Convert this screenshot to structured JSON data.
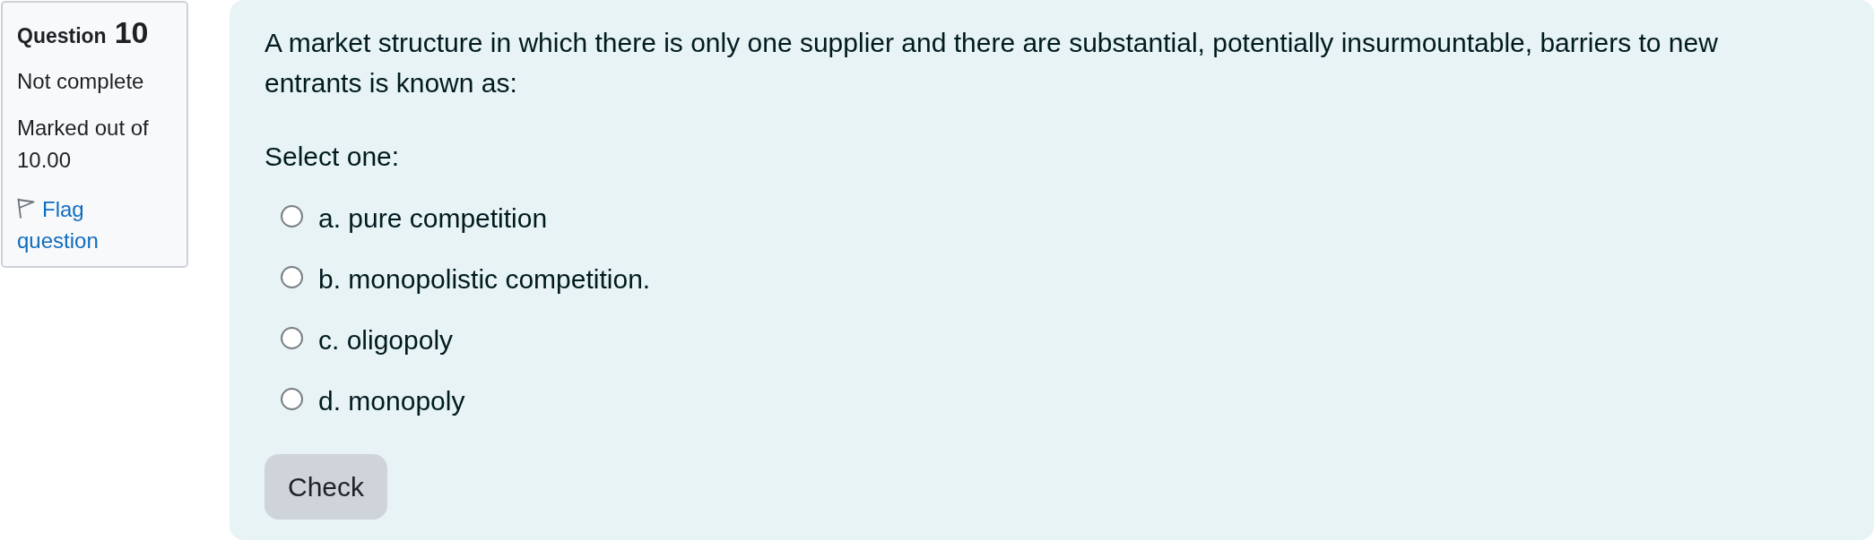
{
  "info": {
    "label": "Question",
    "number": "10",
    "status": "Not complete",
    "marks": "Marked out of 10.00",
    "flag_link": "Flag question"
  },
  "question": {
    "text": "A market structure in which there is only one supplier and there are substantial, potentially insurmountable, barriers to new entrants is known as:",
    "prompt": "Select one:",
    "options": [
      {
        "label": "a. pure competition",
        "selected": false
      },
      {
        "label": "b. monopolistic competition.",
        "selected": false
      },
      {
        "label": "c. oligopoly",
        "selected": false
      },
      {
        "label": "d. monopoly",
        "selected": false
      }
    ],
    "check_button": "Check"
  }
}
